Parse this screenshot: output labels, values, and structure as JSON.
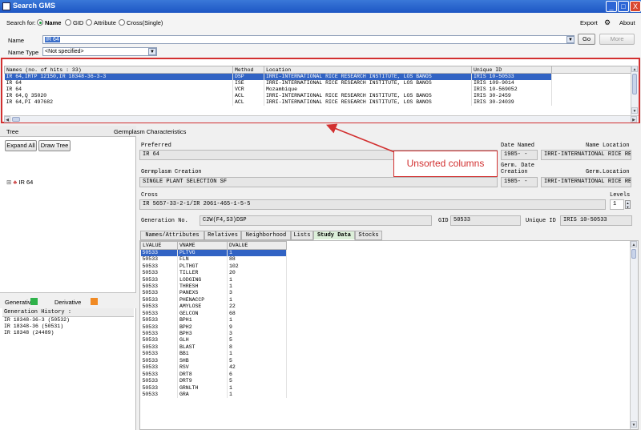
{
  "window": {
    "title": "Search GMS",
    "minimize_glyph": "_",
    "maximize_glyph": "□",
    "close_glyph": "X"
  },
  "search": {
    "search_for_label": "Search for:",
    "options": [
      "Name",
      "GID",
      "Attribute",
      "Cross(Single)"
    ],
    "selected_option": "Name",
    "name_label": "Name",
    "name_value": "IR 64",
    "name_type_label": "Name Type",
    "name_type_value": "<Not specified>",
    "go_label": "Go",
    "more_label": "More",
    "export_label": "Export",
    "about_label": "About"
  },
  "results": {
    "columns": [
      "Names (no. of hits : 33)",
      "Method",
      "Location",
      "Unique ID"
    ],
    "rows": [
      [
        "IR 64,IRTP 12150,IR 18348-36-3-3",
        "DSP",
        "IRRI-INTERNATIONAL RICE RESEARCH INSTITUTE, LOS BANOS",
        "IRIS 10-50533"
      ],
      [
        "IR 64",
        "ISE",
        "IRRI-INTERNATIONAL RICE RESEARCH INSTITUTE, LOS BANOS",
        "IRIS 109-9014"
      ],
      [
        "IR 64",
        "VCR",
        "Mozambique",
        "IRIS 10-569052"
      ],
      [
        "IR 64,Q 35020",
        "ACL",
        "IRRI-INTERNATIONAL RICE RESEARCH INSTITUTE, LOS BANOS",
        "IRIS 30-2459"
      ],
      [
        "IR 64,PI 497682",
        "ACL",
        "IRRI-INTERNATIONAL RICE RESEARCH INSTITUTE, LOS BANOS",
        "IRIS 30-24039"
      ]
    ],
    "selected_row": 0
  },
  "annotation": {
    "text": "Unsorted columns",
    "color": "#d23030"
  },
  "left": {
    "tree_label": "Tree",
    "expand_all_label": "Expand All",
    "draw_tree_label": "Draw Tree",
    "tree_node_label": "IR 64",
    "generative_label": "Generative",
    "derivative_label": "Derivative",
    "generative_color": "#2fb24a",
    "derivative_color": "#f08a24",
    "history_title": "Generation History :",
    "history": [
      "IR 18348-36-3 (50532)",
      "IR 18348-36 (50531)",
      "IR 18348 (24489)"
    ]
  },
  "detail": {
    "header": "Germplasm Characteristics",
    "preferred_label": "Preferred",
    "preferred_value": "IR 64",
    "date_named_label": "Date Named",
    "date_named_value": "1985-  -",
    "name_location_label": "Name Location",
    "name_location_value": "IRRI-INTERNATIONAL RICE RE",
    "creation_label": "Germplasm Creation",
    "creation_value": "SINGLE PLANT SELECTION SF",
    "germ_date_label1": "Germ. Date",
    "germ_date_label2": "Creation",
    "germ_date_value": "1985-  -",
    "germ_location_label": "Germ.Location",
    "germ_location_value": "IRRI-INTERNATIONAL RICE RE",
    "cross_label": "Cross",
    "cross_value": "IR 5657-33-2-1/IR 2061-465-1-5-5",
    "levels_label": "Levels",
    "levels_value": "1",
    "generation_label": "Generation No.",
    "generation_value": "C2W(F4,S3)DSP",
    "gid_label": "GID",
    "gid_value": "50533",
    "unique_id_label": "Unique ID",
    "unique_id_value": "IRIS 10-50533"
  },
  "tabs": [
    "Names/Attributes",
    "Relatives",
    "Neighborhood",
    "Lists",
    "Study Data",
    "Stocks"
  ],
  "active_tab": "Study Data",
  "study": {
    "columns": [
      "LVALUE",
      "VNAME",
      "DVALUE"
    ],
    "rows": [
      [
        "50533",
        "PLTVG",
        "1"
      ],
      [
        "50533",
        "FLN",
        "88"
      ],
      [
        "50533",
        "PLTHGT",
        "102"
      ],
      [
        "50533",
        "TILLER",
        "20"
      ],
      [
        "50533",
        "LODGING",
        "1"
      ],
      [
        "50533",
        "THRESH",
        "1"
      ],
      [
        "50533",
        "PANEXS",
        "3"
      ],
      [
        "50533",
        "PHENACCP",
        "1"
      ],
      [
        "50533",
        "AMYLOSE",
        "22"
      ],
      [
        "50533",
        "GELCON",
        "68"
      ],
      [
        "50533",
        "BPH1",
        "1"
      ],
      [
        "50533",
        "BPH2",
        "9"
      ],
      [
        "50533",
        "BPH3",
        "3"
      ],
      [
        "50533",
        "GLH",
        "5"
      ],
      [
        "50533",
        "BLAST",
        "8"
      ],
      [
        "50533",
        "BB1",
        "1"
      ],
      [
        "50533",
        "SHB",
        "5"
      ],
      [
        "50533",
        "RSV",
        "42"
      ],
      [
        "50533",
        "DRT8",
        "6"
      ],
      [
        "50533",
        "DRT9",
        "5"
      ],
      [
        "50533",
        "GRNLTH",
        "1"
      ],
      [
        "50533",
        "GRA",
        "1"
      ]
    ],
    "selected_row": 0
  }
}
